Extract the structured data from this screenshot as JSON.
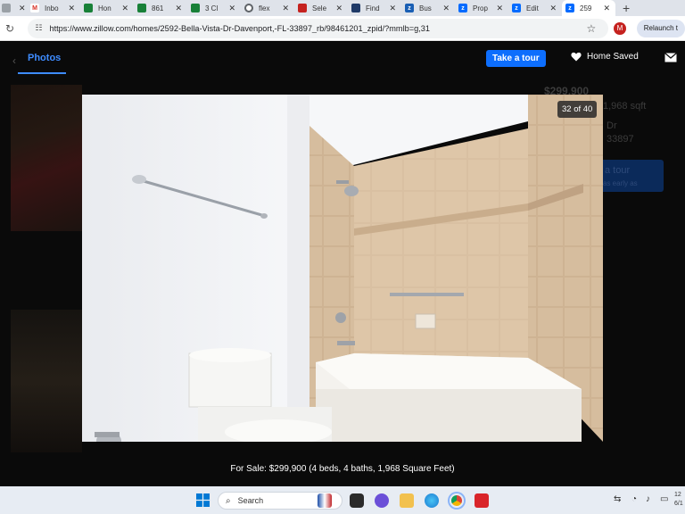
{
  "browser": {
    "tabs": [
      {
        "label": "",
        "favicon": "generic",
        "color": "#9aa0a6"
      },
      {
        "label": "Inbo",
        "favicon": "M",
        "color": "#d93025"
      },
      {
        "label": "Hon",
        "favicon": "drive",
        "color": "#188038"
      },
      {
        "label": "861",
        "favicon": "sheet",
        "color": "#188038"
      },
      {
        "label": "3 Cl",
        "favicon": "sheet",
        "color": "#188038"
      },
      {
        "label": "flex",
        "favicon": "circle",
        "color": "#5f6368"
      },
      {
        "label": "Sele",
        "favicon": "tag",
        "color": "#c5221f"
      },
      {
        "label": "Find",
        "favicon": "box",
        "color": "#1f3a68"
      },
      {
        "label": "Bus",
        "favicon": "z",
        "color": "#1a5fb4"
      },
      {
        "label": "Prop",
        "favicon": "z",
        "color": "#006aff"
      },
      {
        "label": "Edit",
        "favicon": "z",
        "color": "#006aff"
      },
      {
        "label": "259",
        "favicon": "z",
        "color": "#006aff",
        "active": true
      }
    ],
    "new_tab": "+",
    "url": "https://www.zillow.com/homes/2592-Bella-Vista-Dr-Davenport,-FL-33897_rb/98461201_zpid/?mmlb=g,31",
    "profile_initial": "M",
    "relaunch_label": "Relaunch t"
  },
  "viewer": {
    "photos_tab": "Photos",
    "take_tour": "Take a tour",
    "home_saved": "Home Saved",
    "counter": "32 of 40",
    "caption": "For Sale: $299,900 (4 beds, 4 baths, 1,968 Square Feet)"
  },
  "background": {
    "price": "$299,900",
    "sqft": "1,968 sqft",
    "street": "Dr",
    "zip": "33897",
    "tour": "a tour",
    "tour_sub": "as early as"
  },
  "taskbar": {
    "search_placeholder": "Search",
    "clock_time": "12",
    "clock_date": "6/1"
  },
  "colors": {
    "zillow_blue": "#0d6efd",
    "photos_accent": "#3e8cff"
  }
}
